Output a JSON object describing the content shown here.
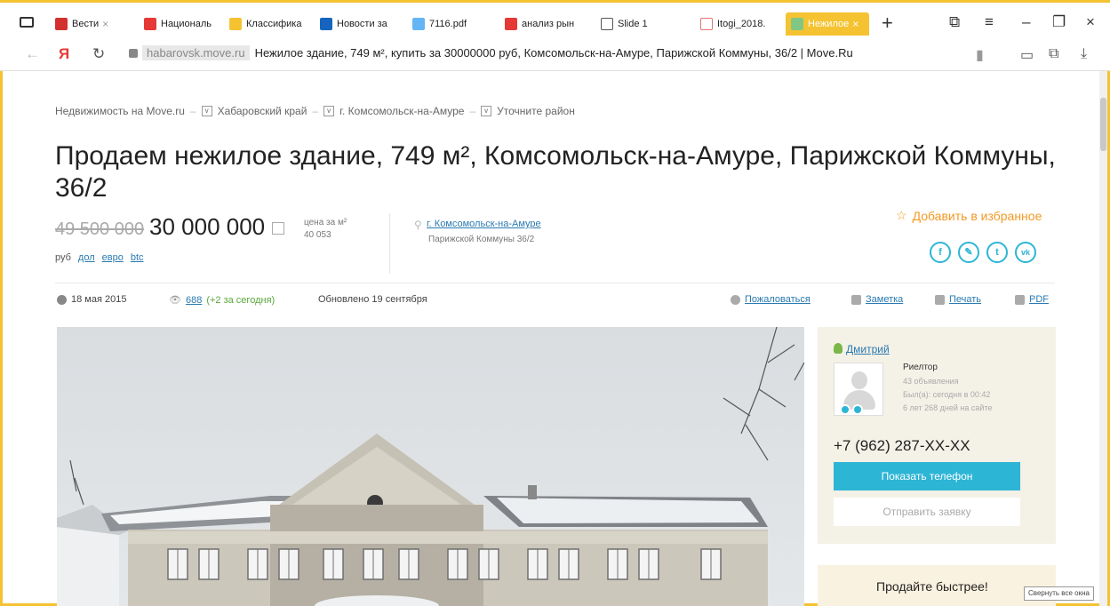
{
  "browser": {
    "tabs": [
      {
        "label": "Вести",
        "favicon_color": "#d32f2f",
        "closable": true
      },
      {
        "label": "Националь",
        "favicon_color": "#e53935",
        "closable": false
      },
      {
        "label": "Классифика",
        "favicon_color": "#f5c332",
        "closable": false
      },
      {
        "label": "Новости за",
        "favicon_color": "#1565c0",
        "closable": false
      },
      {
        "label": "7116.pdf",
        "favicon_color": "#64b5f6",
        "closable": false
      },
      {
        "label": "анализ рын",
        "favicon_color": "#e53935",
        "closable": false
      },
      {
        "label": "Slide 1",
        "favicon_color": "#555555",
        "closable": false
      },
      {
        "label": "Itogi_2018.",
        "favicon_color": "#e57373",
        "closable": false
      },
      {
        "label": "Нежилое",
        "favicon_color": "#81c784",
        "closable": true,
        "active": true
      }
    ],
    "address": {
      "domain": "habarovsk.move.ru",
      "title": "Нежилое здание, 749 м², купить за 30000000 руб, Комсомольск-на-Амуре, Парижской Коммуны, 36/2 | Move.Ru"
    },
    "yandex_logo": "Я"
  },
  "breadcrumbs": [
    {
      "label": "Недвижимость на Move.ru"
    },
    {
      "label": "Хабаровский край"
    },
    {
      "label": "г. Комсомольск-на-Амуре"
    },
    {
      "label": "Уточните район"
    }
  ],
  "listing": {
    "title": "Продаем нежилое здание, 749 м², Комсомольск-на-Амуре, Парижской Коммуны, 36/2",
    "price_old": "49 500 000",
    "price_new": "30 000 000",
    "price_per_m2_label": "цена за м²",
    "price_per_m2_value": "40 053",
    "currency": {
      "rub": "руб",
      "usd": "дол",
      "eur": "евро",
      "btc": "btc"
    },
    "city_link": "г. Комсомольск-на-Амуре",
    "street": "Парижской Коммуны 36/2",
    "favorite_label": "Добавить в избранное",
    "date": "18 мая 2015",
    "views": "688",
    "views_today": "(+2 за сегодня)",
    "updated": "Обновлено 19 сентября",
    "actions": {
      "complain": "Пожаловаться",
      "note": "Заметка",
      "print": "Печать",
      "pdf": "PDF"
    },
    "social": [
      "f",
      "✎",
      "t",
      "vk"
    ]
  },
  "agent": {
    "name": "Дмитрий",
    "role": "Риелтор",
    "listings": "43 объявления",
    "last_seen": "Был(а): сегодня в 00:42",
    "tenure": "6 лет 268 дней на сайте",
    "phone": "+7 (962) 287-XX-XX",
    "show_phone_label": "Показать телефон",
    "send_request_label": "Отправить заявку"
  },
  "promo": {
    "text": "Продайте быстрее!"
  },
  "tooltip": "Свернуть все окна",
  "colors": {
    "accent_yellow": "#f5c332",
    "link_blue": "#2a7ab0",
    "button_cyan": "#2db5d6",
    "favorite_orange": "#f39a24"
  }
}
